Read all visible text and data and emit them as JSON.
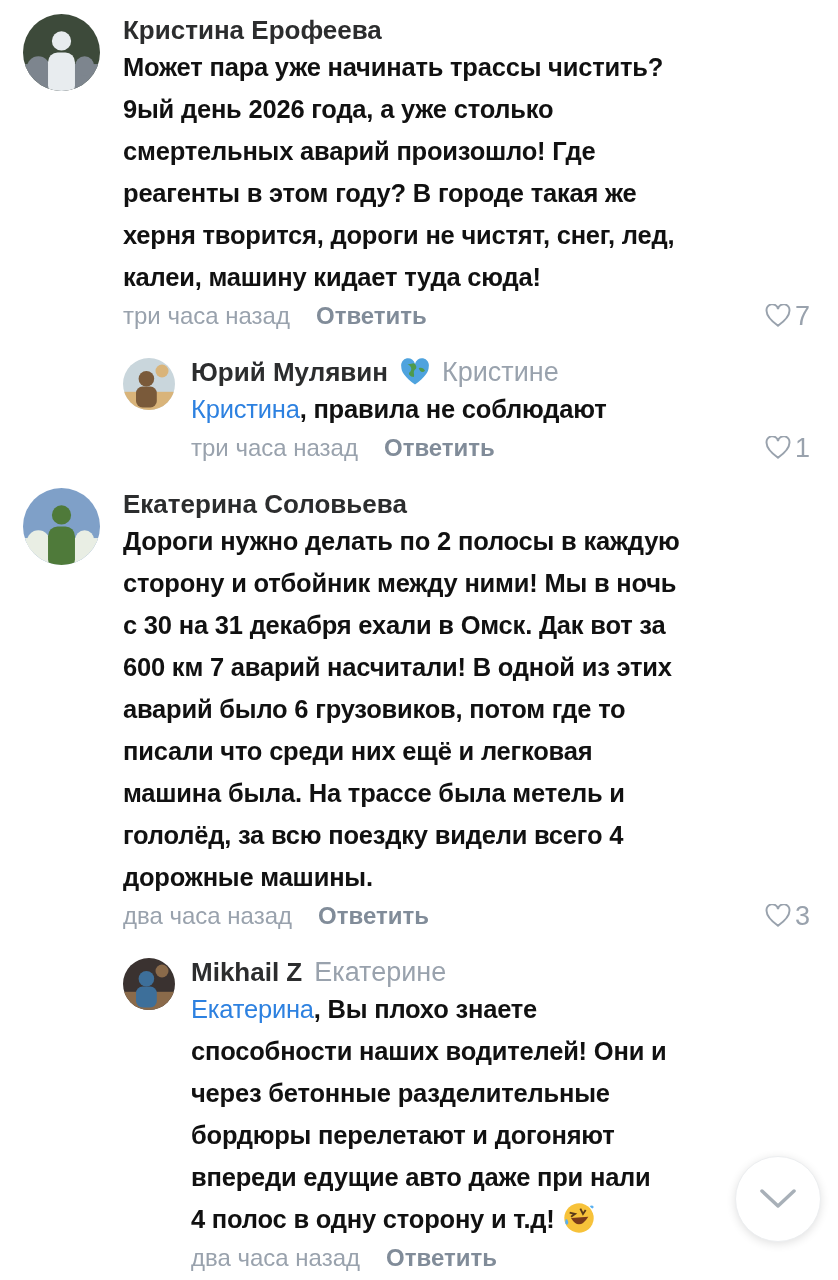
{
  "comments": [
    {
      "author": "Кристина Ерофеева",
      "text": "Может пара уже начинать трассы чистить?\n9ый день 2026 года, а уже столько\nсмертельных аварий произошло! Где\nреагенты в этом году? В городе такая же\nхерня творится, дороги не чистят, снег, лед,\nкалеи, машину кидает туда сюда!",
      "time": "три часа назад",
      "reply_label": "Ответить",
      "likes": "7",
      "children": [
        {
          "author": "Юрий Мулявин",
          "badge": true,
          "reply_to": "Кристине",
          "mention": "Кристина",
          "text": ", правила не соблюдают",
          "time": "три часа назад",
          "reply_label": "Ответить",
          "likes": "1"
        }
      ]
    },
    {
      "author": "Екатерина Соловьева",
      "text": "Дороги нужно делать по 2 полосы в каждую\nсторону и отбойник между ними! Мы в ночь\nс 30 на 31 декабря ехали в Омск. Дак вот за\n600 км 7 аварий насчитали! В одной из этих\nаварий было 6 грузовиков, потом где то\nписали что среди них ещё и легковая\nмашина была. На трассе была метель и\nгололёд, за всю поездку видели всего 4\nдорожные машины.",
      "time": "два часа назад",
      "reply_label": "Ответить",
      "likes": "3",
      "children": [
        {
          "author": "Mikhail Z",
          "reply_to": "Екатерине",
          "mention": "Екатерина",
          "text": ", Вы плохо знаете\nспособности наших водителей! Они и\nчерез бетонные разделительные\nбордюры перелетают и догоняют\nвпереди едущие авто даже при нали\n4 полос в одну сторону и т.д!",
          "emoji": true,
          "time": "два часа назад",
          "reply_label": "Ответить"
        }
      ]
    }
  ]
}
